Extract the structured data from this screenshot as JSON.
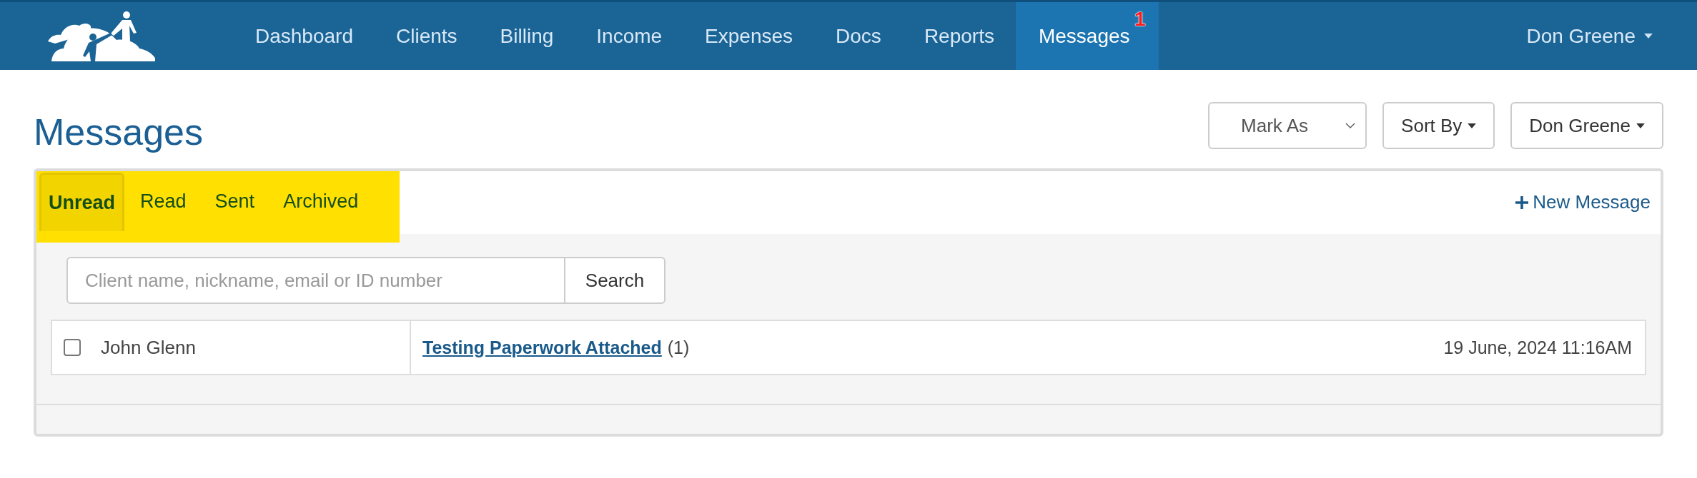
{
  "navbar": {
    "items": [
      {
        "label": "Dashboard",
        "selected": false
      },
      {
        "label": "Clients",
        "selected": false
      },
      {
        "label": "Billing",
        "selected": false
      },
      {
        "label": "Income",
        "selected": false
      },
      {
        "label": "Expenses",
        "selected": false
      },
      {
        "label": "Docs",
        "selected": false
      },
      {
        "label": "Reports",
        "selected": false
      },
      {
        "label": "Messages",
        "selected": true,
        "badge": "1"
      }
    ],
    "user": "Don Greene"
  },
  "header": {
    "title": "Messages",
    "mark_as": "Mark As",
    "sort_by": "Sort By",
    "owner": "Don Greene"
  },
  "tabs": [
    {
      "label": "Unread",
      "selected": true
    },
    {
      "label": "Read",
      "selected": false
    },
    {
      "label": "Sent",
      "selected": false
    },
    {
      "label": "Archived",
      "selected": false
    }
  ],
  "new_message": "New Message",
  "search": {
    "placeholder": "Client name, nickname, email or ID number",
    "button": "Search"
  },
  "rows": [
    {
      "checked": false,
      "client": "John Glenn",
      "subject": "Testing Paperwork Attached",
      "count": "(1)",
      "date": "19 June, 2024 11:16AM"
    }
  ]
}
